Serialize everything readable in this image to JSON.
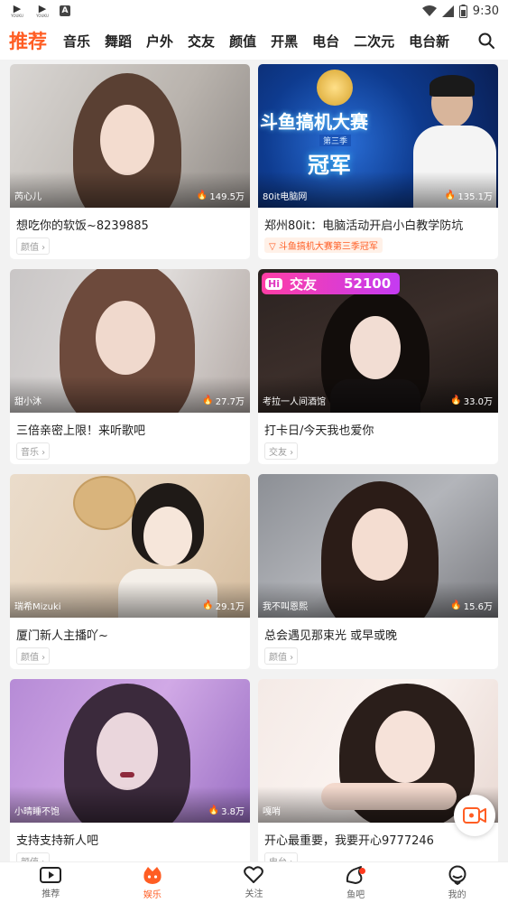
{
  "status_bar": {
    "app_icons": [
      {
        "glyph": "▶",
        "label": "YOUKU"
      },
      {
        "glyph": "▶",
        "label": "YOUKU"
      }
    ],
    "a_icon": "A",
    "icons": [
      "wifi-icon",
      "signal-icon",
      "battery-icon"
    ],
    "time": "9:30"
  },
  "nav": {
    "tabs": [
      "推荐",
      "音乐",
      "舞蹈",
      "户外",
      "交友",
      "颜值",
      "开黑",
      "电台",
      "二次元",
      "电台新"
    ],
    "active_index": 0,
    "accent_color": "#ff5d23"
  },
  "cards": [
    {
      "anchor": "芮心儿",
      "viewers": "149.5万",
      "title": "想吃你的软饭~8239885",
      "tag": "颜值"
    },
    {
      "anchor": "80it电脑网",
      "viewers": "135.1万",
      "title": "郑州80it：电脑活动开启小白教学防坑",
      "promo": "斗鱼搞机大赛第三季冠军",
      "banner_title": "斗鱼搞机大赛",
      "banner_season": "第三季",
      "banner_sub": "冠军"
    },
    {
      "anchor": "甜小沐",
      "viewers": "27.7万",
      "title": "三倍亲密上限！来听歌吧",
      "tag": "音乐"
    },
    {
      "anchor": "考拉一人间酒馆",
      "viewers": "33.0万",
      "title": "打卡日/今天我也爱你",
      "tag": "交友",
      "badge_hi": "Hi",
      "badge_text": "交友",
      "badge_num": "52100"
    },
    {
      "anchor": "瑞希Mizuki",
      "viewers": "29.1万",
      "title": "厦门新人主播吖~",
      "tag": "颜值"
    },
    {
      "anchor": "我不叫恩熙",
      "viewers": "15.6万",
      "title": "总会遇见那束光 或早或晚",
      "tag": "颜值"
    },
    {
      "anchor": "小晴睡不饱",
      "viewers": "3.8万",
      "title": "支持支持新人吧",
      "tag": "颜值"
    },
    {
      "anchor": "嘎哨",
      "viewers": "",
      "title": "开心最重要，我要开心9777246",
      "tag": "电台"
    }
  ],
  "tabbar": {
    "items": [
      {
        "label": "推荐",
        "icon": "video-camera-icon"
      },
      {
        "label": "娱乐",
        "icon": "entertainment-icon"
      },
      {
        "label": "关注",
        "icon": "heart-icon"
      },
      {
        "label": "鱼吧",
        "icon": "fish-bar-icon"
      },
      {
        "label": "我的",
        "icon": "profile-icon"
      }
    ],
    "active_index": 1
  }
}
